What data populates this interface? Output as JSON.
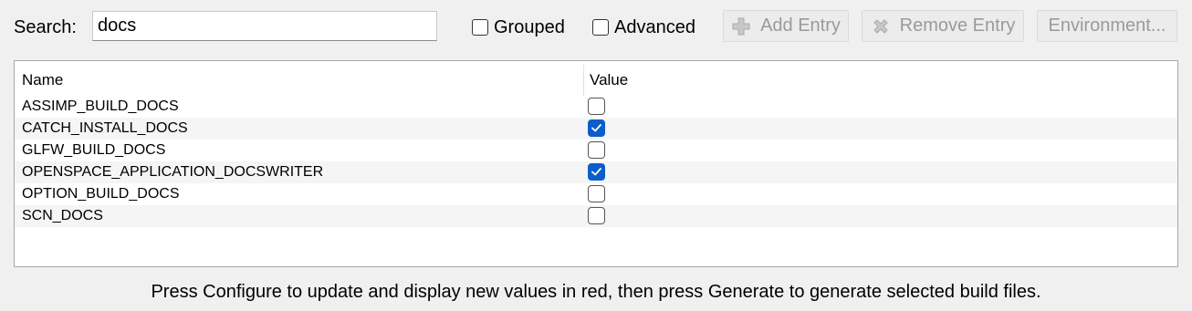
{
  "toolbar": {
    "search_label": "Search:",
    "search_value": "docs",
    "grouped_label": "Grouped",
    "grouped_checked": false,
    "advanced_label": "Advanced",
    "advanced_checked": false,
    "add_entry_label": "Add Entry",
    "add_entry_icon": "plus-icon",
    "remove_entry_label": "Remove Entry",
    "remove_entry_icon": "x-icon",
    "environment_label": "Environment..."
  },
  "table": {
    "columns": [
      "Name",
      "Value"
    ],
    "rows": [
      {
        "name": "ASSIMP_BUILD_DOCS",
        "value": false
      },
      {
        "name": "CATCH_INSTALL_DOCS",
        "value": true
      },
      {
        "name": "GLFW_BUILD_DOCS",
        "value": false
      },
      {
        "name": "OPENSPACE_APPLICATION_DOCSWRITER",
        "value": true
      },
      {
        "name": "OPTION_BUILD_DOCS",
        "value": false
      },
      {
        "name": "SCN_DOCS",
        "value": false
      }
    ]
  },
  "status_text": "Press Configure to update and display new values in red, then press Generate to generate selected build files.",
  "colors": {
    "checkbox_checked": "#0a5fc8",
    "disabled_text": "#9a9a9a",
    "window_bg": "#f0f0f0"
  }
}
